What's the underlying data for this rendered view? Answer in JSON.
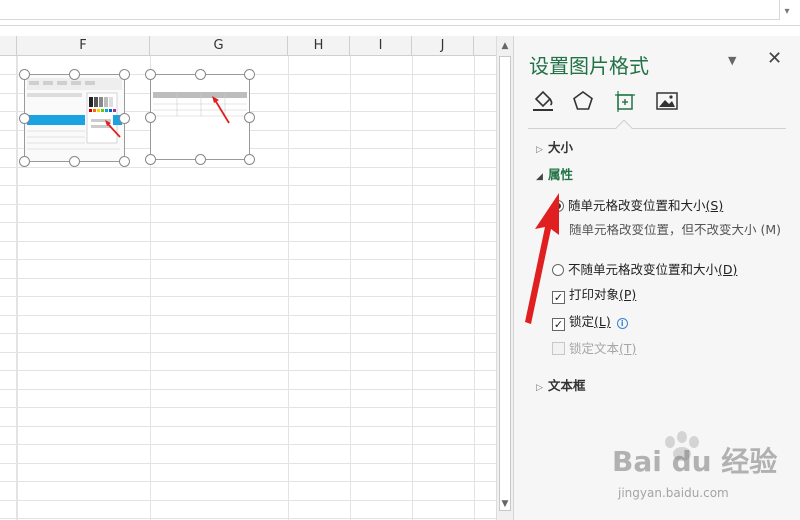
{
  "columns": [
    "F",
    "G",
    "H",
    "I",
    "J"
  ],
  "pane": {
    "title": "设置图片格式",
    "menu_icon": "triangle-down",
    "close_icon": "×",
    "tabs": [
      "fill-line-icon",
      "effects-icon",
      "size-properties-icon",
      "picture-icon"
    ],
    "sections": {
      "size": "大小",
      "properties": "属性",
      "textbox": "文本框"
    },
    "options": {
      "move_and_size": {
        "label": "随单元格改变位置和大小",
        "key": "(S)",
        "selected": true
      },
      "move_only_garbled": "随单元格改变位置，但不改变大小 (M)",
      "dont_move": {
        "label": "不随单元格改变位置和大小",
        "key": "(D)",
        "selected": false
      },
      "print_object": {
        "label": "打印对象",
        "key": "(P)",
        "checked": true
      },
      "locked": {
        "label": "锁定",
        "key": "(L)",
        "checked": true
      },
      "lock_text": {
        "label": "锁定文本",
        "key": "(T)",
        "checked": false,
        "disabled": true
      }
    }
  },
  "watermark": {
    "brand": "Bai du 经验",
    "url": "jingyan.baidu.com"
  },
  "colors": {
    "accent_green": "#217346",
    "arrow_red": "#e02020",
    "table_blue": "#1aa3e0"
  }
}
